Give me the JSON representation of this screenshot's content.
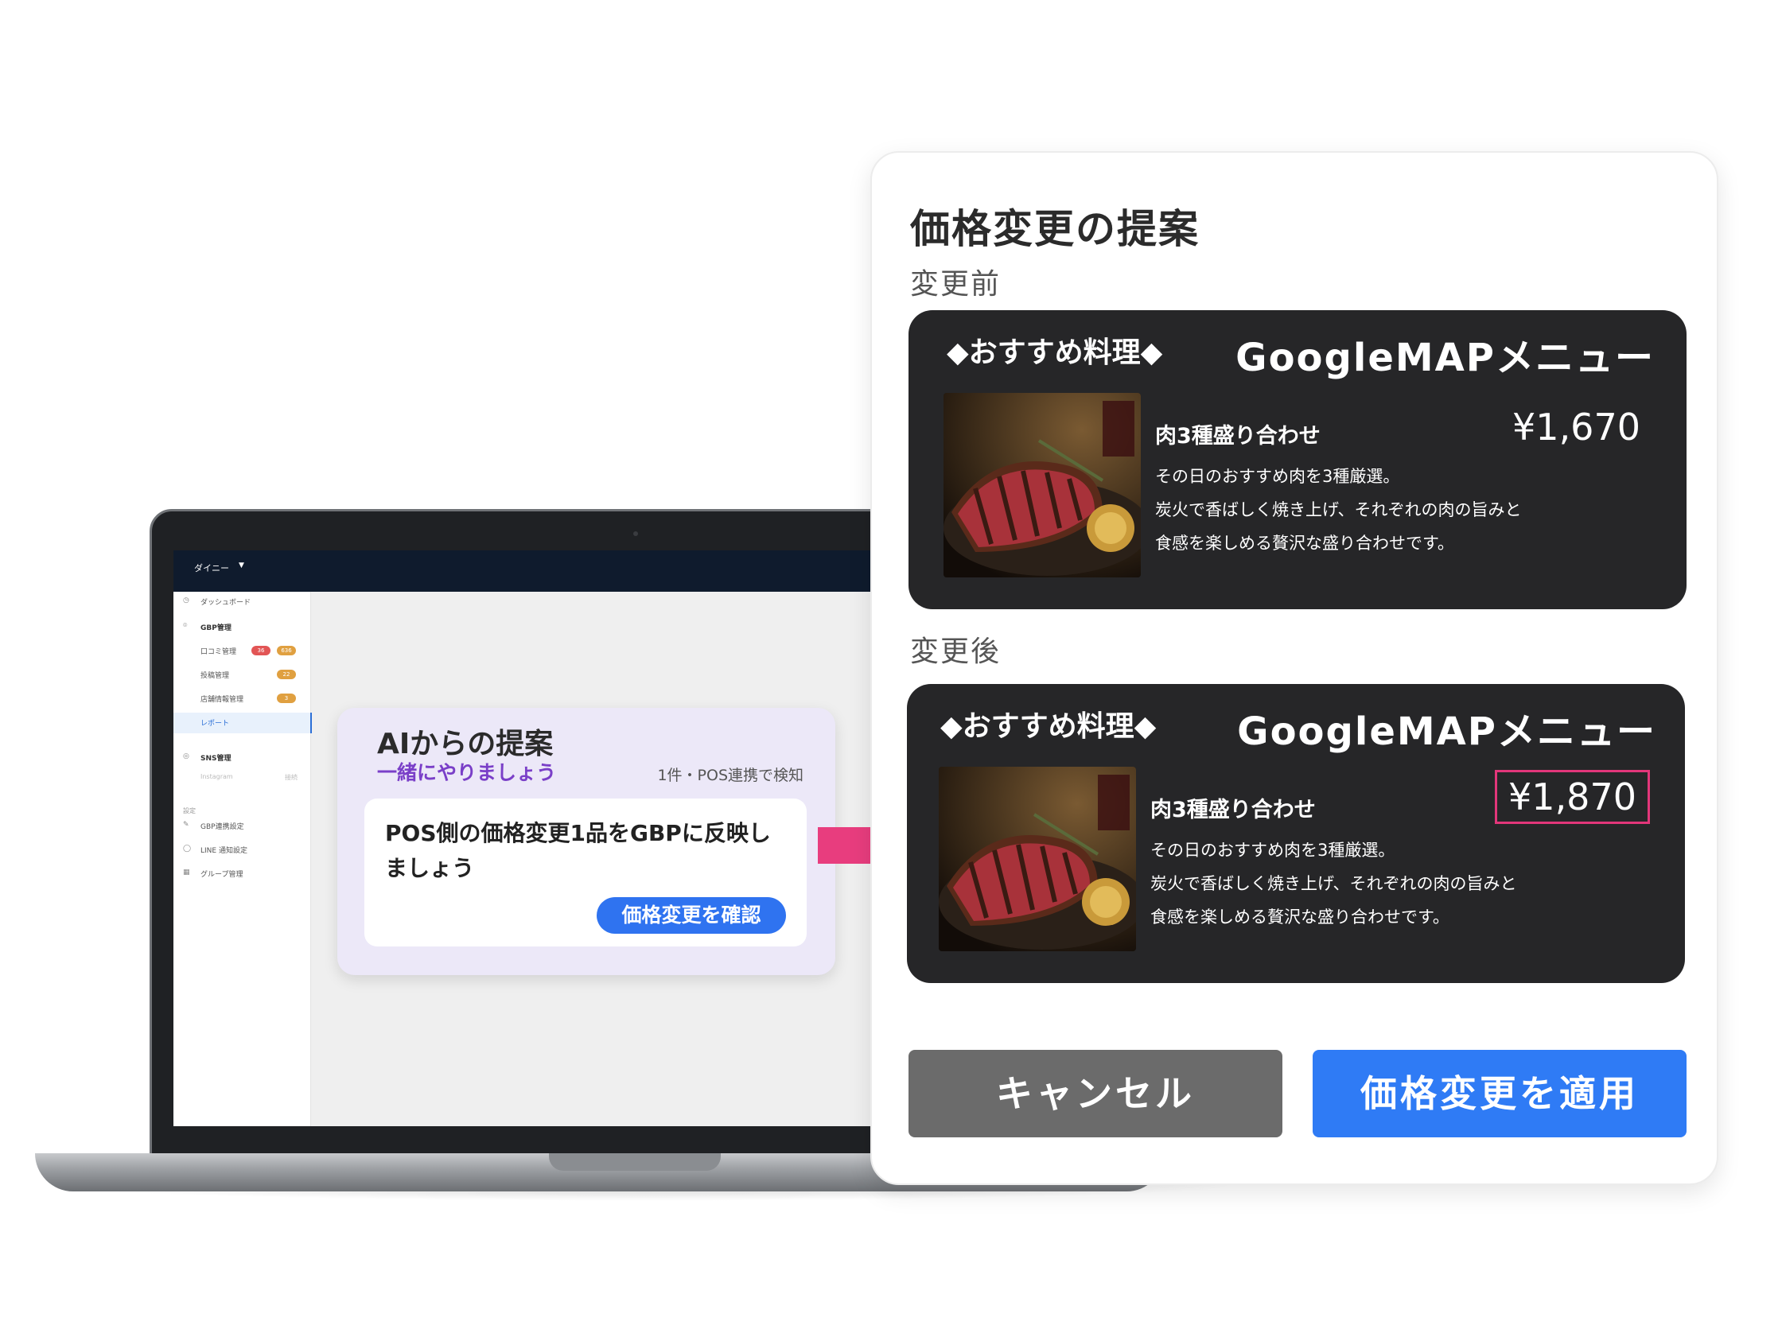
{
  "dashboard": {
    "org_name": "ダイニー",
    "nav": [
      {
        "icon": "dashboard-icon",
        "label": "ダッシュボード"
      },
      {
        "icon": "pin-icon",
        "label": "GBP管理"
      }
    ],
    "gbp_sub": [
      {
        "label": "口コミ管理",
        "badges": [
          {
            "text": "36",
            "color": "#e25555"
          },
          {
            "text": "636",
            "color": "#e0a040"
          }
        ]
      },
      {
        "label": "投稿管理",
        "badges": [
          {
            "text": "22",
            "color": "#e0a040"
          }
        ]
      },
      {
        "label": "店舗情報管理",
        "badges": [
          {
            "text": "3",
            "color": "#e0a040"
          }
        ]
      },
      {
        "label": "レポート",
        "badges": []
      }
    ],
    "sns": {
      "label": "SNS管理",
      "sub_label": "Instagram",
      "sub_status": "接続"
    },
    "settings_section": "設定",
    "settings": [
      {
        "label": "GBP連携設定"
      },
      {
        "label": "LINE 通知設定"
      },
      {
        "label": "グループ管理"
      }
    ]
  },
  "ai_card": {
    "title": "AIからの提案",
    "subtitle": "一緒にやりましょう",
    "meta": "1件・POS連携で検知",
    "message": "POS側の価格変更1品をGBPに反映しましょう",
    "button": "価格変更を確認"
  },
  "modal": {
    "title": "価格変更の提案",
    "before_label": "変更前",
    "after_label": "変更後",
    "before": {
      "header_left": "◆おすすめ料理◆",
      "header_right": "GoogleMAPメニュー",
      "item_name": "肉3種盛り合わせ",
      "price": "¥1,670",
      "desc_1": "その日のおすすめ肉を3種厳選。",
      "desc_2": "炭火で香ばしく焼き上げ、それぞれの肉の旨みと",
      "desc_3": "食感を楽しめる贅沢な盛り合わせです。"
    },
    "after": {
      "header_left": "◆おすすめ料理◆",
      "header_right": "GoogleMAPメニュー",
      "item_name": "肉3種盛り合わせ",
      "price": "¥1,870",
      "desc_1": "その日のおすすめ肉を3種厳選。",
      "desc_2": "炭火で香ばしく焼き上げ、それぞれの肉の旨みと",
      "desc_3": "食感を楽しめる贅沢な盛り合わせです。"
    },
    "cancel_button": "キャンセル",
    "apply_button": "価格変更を適用"
  },
  "colors": {
    "accent_blue": "#2f7bf5",
    "highlight_pink": "#e2367a",
    "arrow_pink": "#e83d7e",
    "ai_purple": "#7a3fc8"
  }
}
